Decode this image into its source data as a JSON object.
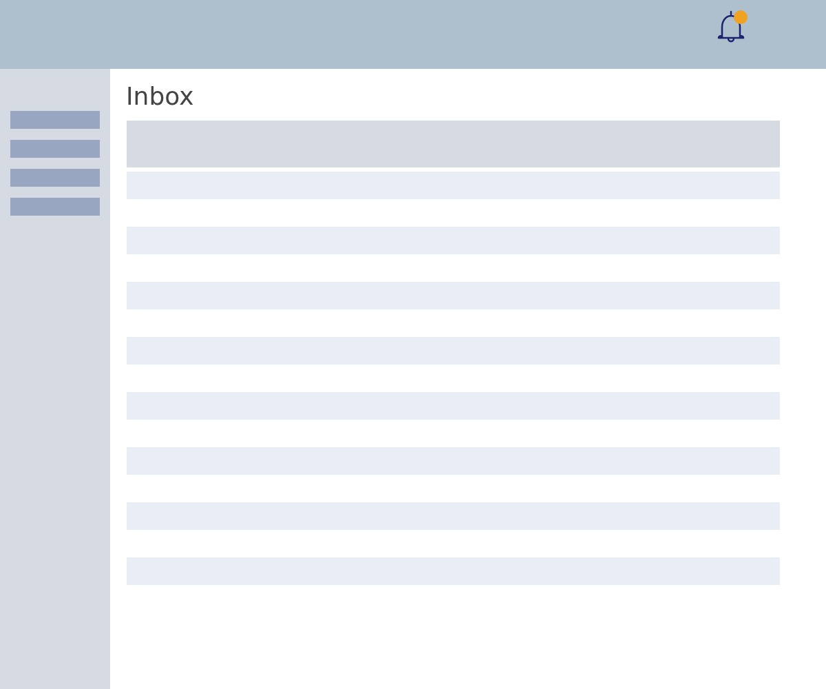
{
  "header": {
    "notifications": {
      "unread": true
    }
  },
  "sidebar": {
    "items": [
      {
        "kind": "placeholder"
      },
      {
        "kind": "placeholder"
      },
      {
        "kind": "placeholder"
      },
      {
        "kind": "placeholder"
      }
    ]
  },
  "main": {
    "title": "Inbox",
    "table": {
      "header": {
        "kind": "placeholder"
      },
      "rows": [
        {
          "kind": "placeholder"
        },
        {
          "kind": "placeholder"
        },
        {
          "kind": "placeholder"
        },
        {
          "kind": "placeholder"
        },
        {
          "kind": "placeholder"
        },
        {
          "kind": "placeholder"
        },
        {
          "kind": "placeholder"
        },
        {
          "kind": "placeholder"
        }
      ]
    }
  }
}
